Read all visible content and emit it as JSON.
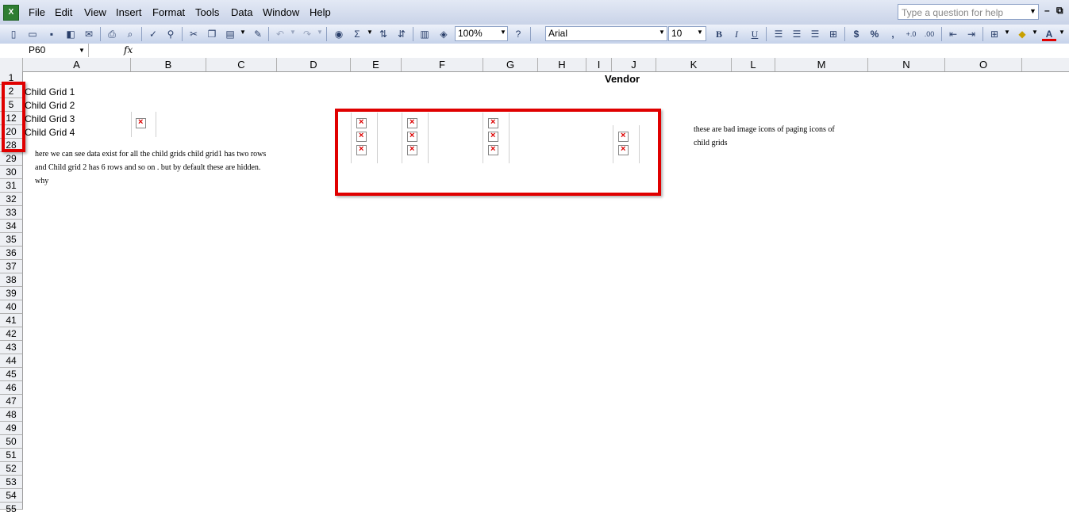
{
  "menu": [
    "File",
    "Edit",
    "View",
    "Insert",
    "Format",
    "Tools",
    "Data",
    "Window",
    "Help"
  ],
  "help_placeholder": "Type a question for help",
  "toolbar": {
    "zoom": "100%",
    "font": "Arial",
    "size": "10",
    "bold": "B",
    "italic": "I",
    "underline": "U",
    "currency": "$",
    "percent": "%",
    "comma": ","
  },
  "formula_bar": {
    "name_box": "P60",
    "fx": "fx"
  },
  "columns": [
    "A",
    "B",
    "C",
    "D",
    "E",
    "F",
    "G",
    "H",
    "I",
    "J",
    "K",
    "L",
    "M",
    "N",
    "O"
  ],
  "rows": [
    "1",
    "2",
    "5",
    "12",
    "20",
    "28",
    "29",
    "30",
    "31",
    "32",
    "33",
    "34",
    "35",
    "36",
    "37",
    "38",
    "39",
    "40",
    "41",
    "42",
    "43",
    "44",
    "45",
    "46",
    "47",
    "48",
    "49",
    "50",
    "51",
    "52",
    "53",
    "54",
    "55"
  ],
  "cells": {
    "vendor": "Vendor",
    "child1": "Child Grid 1",
    "child2": "Child Grid 2",
    "child3": "Child Grid 3",
    "child4": "Child Grid 4"
  },
  "notes": {
    "left_line1": "here we can see  data exist for all  the child grids child grid1 has two rows",
    "left_line2": "and Child grid 2 has 6 rows   and so on . but by default these  are hidden.",
    "left_line3": "why",
    "right_line1": "these  are bad image icons of paging icons  of",
    "right_line2": "child grids"
  },
  "colors": {
    "highlight": "#e00000",
    "broken_x": "#dd0000"
  }
}
